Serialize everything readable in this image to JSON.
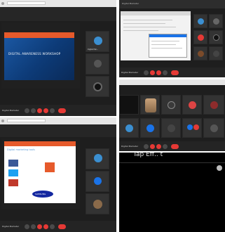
{
  "panels": {
    "p1": {
      "slide_title": "DIGITAL AWARENESS WORKSHOP",
      "presenter_label": "Digital Marketer",
      "tile_names": [
        "Digital Mar...",
        "",
        ""
      ]
    },
    "p2": {
      "title_bar": "Digital Marketer",
      "presenter_label": "Digital Marketer"
    },
    "p3": {
      "presenter_label": "Digital Marketer"
    },
    "p4": {
      "slide_heading": "Digital marketing tools",
      "presenter_label": "Digital Marketer",
      "brand_logo": "SAMSUNG"
    },
    "p5": {
      "overlay_text": "Tap Eff.. t"
    }
  },
  "colors": {
    "bg": "#1e1e1e",
    "end_call": "#e53935",
    "slide_blue": "#0d3b78",
    "accent_blue": "#1a73e8"
  }
}
